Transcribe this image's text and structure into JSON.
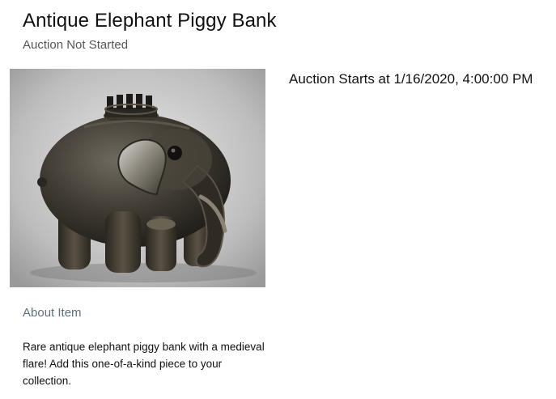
{
  "item": {
    "title": "Antique Elephant Piggy Bank",
    "status": "Auction Not Started",
    "image_alt": "Antique elephant piggy bank with crown on top",
    "auction_starts": "Auction Starts at 1/16/2020, 4:00:00 PM"
  },
  "about": {
    "heading": "About Item",
    "description": "Rare antique elephant piggy bank with a medieval flare! Add this one-of-a-kind piece to your collection."
  }
}
